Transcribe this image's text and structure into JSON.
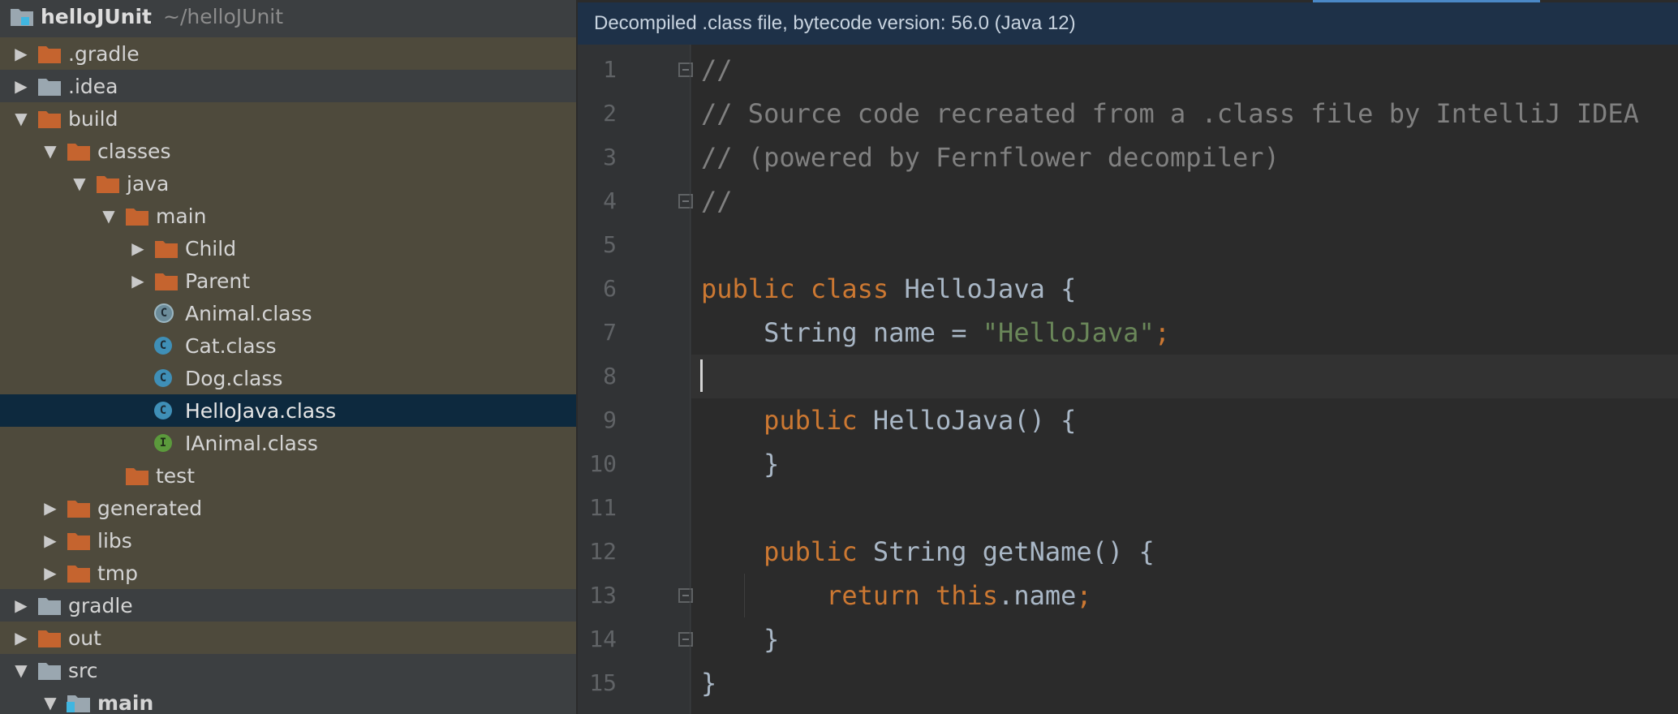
{
  "project": {
    "name": "helloJUnit",
    "path": "~/helloJUnit"
  },
  "tree": [
    {
      "label": ".gradle",
      "depth": 0,
      "arrow": "collapsed",
      "icon": "folder-orange-icon",
      "excluded": true
    },
    {
      "label": ".idea",
      "depth": 0,
      "arrow": "collapsed",
      "icon": "folder-grey-icon"
    },
    {
      "label": "build",
      "depth": 0,
      "arrow": "expanded",
      "icon": "folder-orange-icon",
      "excluded": true
    },
    {
      "label": "classes",
      "depth": 1,
      "arrow": "expanded",
      "icon": "folder-orange-icon",
      "excluded": true
    },
    {
      "label": "java",
      "depth": 2,
      "arrow": "expanded",
      "icon": "folder-orange-icon",
      "excluded": true
    },
    {
      "label": "main",
      "depth": 3,
      "arrow": "expanded",
      "icon": "folder-orange-icon",
      "excluded": true
    },
    {
      "label": "Child",
      "depth": 4,
      "arrow": "collapsed",
      "icon": "folder-orange-icon",
      "excluded": true
    },
    {
      "label": "Parent",
      "depth": 4,
      "arrow": "collapsed",
      "icon": "folder-orange-icon",
      "excluded": true
    },
    {
      "label": "Animal.class",
      "depth": 4,
      "arrow": "none",
      "icon": "abstract-class-icon",
      "excluded": true
    },
    {
      "label": "Cat.class",
      "depth": 4,
      "arrow": "none",
      "icon": "class-icon",
      "excluded": true
    },
    {
      "label": "Dog.class",
      "depth": 4,
      "arrow": "none",
      "icon": "class-icon",
      "excluded": true
    },
    {
      "label": "HelloJava.class",
      "depth": 4,
      "arrow": "none",
      "icon": "class-icon",
      "selected": true
    },
    {
      "label": "IAnimal.class",
      "depth": 4,
      "arrow": "none",
      "icon": "interface-icon",
      "excluded": true
    },
    {
      "label": "test",
      "depth": 3,
      "arrow": "none",
      "icon": "folder-orange-icon",
      "excluded": true
    },
    {
      "label": "generated",
      "depth": 1,
      "arrow": "collapsed",
      "icon": "folder-orange-icon",
      "excluded": true
    },
    {
      "label": "libs",
      "depth": 1,
      "arrow": "collapsed",
      "icon": "folder-orange-icon",
      "excluded": true
    },
    {
      "label": "tmp",
      "depth": 1,
      "arrow": "collapsed",
      "icon": "folder-orange-icon",
      "excluded": true
    },
    {
      "label": "gradle",
      "depth": 0,
      "arrow": "collapsed",
      "icon": "folder-grey-icon"
    },
    {
      "label": "out",
      "depth": 0,
      "arrow": "collapsed",
      "icon": "folder-orange-icon",
      "excluded": true
    },
    {
      "label": "src",
      "depth": 0,
      "arrow": "expanded",
      "icon": "folder-grey-icon"
    },
    {
      "label": "main",
      "depth": 1,
      "arrow": "expanded",
      "icon": "source-folder-icon",
      "bold": true
    }
  ],
  "editor": {
    "banner": "Decompiled .class file, bytecode version: 56.0 (Java 12)",
    "current_line": 8,
    "lines": [
      {
        "n": "1",
        "tokens": [
          {
            "t": "//",
            "c": "comment"
          }
        ]
      },
      {
        "n": "2",
        "tokens": [
          {
            "t": "// Source code recreated from a .class file by IntelliJ IDEA",
            "c": "comment"
          }
        ]
      },
      {
        "n": "3",
        "tokens": [
          {
            "t": "// (powered by Fernflower decompiler)",
            "c": "comment"
          }
        ]
      },
      {
        "n": "4",
        "tokens": [
          {
            "t": "//",
            "c": "comment"
          }
        ]
      },
      {
        "n": "5",
        "tokens": []
      },
      {
        "n": "6",
        "tokens": [
          {
            "t": "public class ",
            "c": "keyword"
          },
          {
            "t": "HelloJava {",
            "c": "ident"
          }
        ]
      },
      {
        "n": "7",
        "tokens": [
          {
            "t": "    String name = ",
            "c": "ident"
          },
          {
            "t": "\"HelloJava\"",
            "c": "string"
          },
          {
            "t": ";",
            "c": "keyword"
          }
        ]
      },
      {
        "n": "8",
        "tokens": []
      },
      {
        "n": "9",
        "tokens": [
          {
            "t": "    ",
            "c": "ident"
          },
          {
            "t": "public ",
            "c": "keyword"
          },
          {
            "t": "HelloJava() {",
            "c": "ident"
          }
        ]
      },
      {
        "n": "10",
        "tokens": [
          {
            "t": "    }",
            "c": "ident"
          }
        ]
      },
      {
        "n": "11",
        "tokens": []
      },
      {
        "n": "12",
        "tokens": [
          {
            "t": "    ",
            "c": "ident"
          },
          {
            "t": "public ",
            "c": "keyword"
          },
          {
            "t": "String getName() {",
            "c": "ident"
          }
        ]
      },
      {
        "n": "13",
        "tokens": [
          {
            "t": "        ",
            "c": "ident"
          },
          {
            "t": "return this",
            "c": "keyword"
          },
          {
            "t": ".name",
            "c": "ident"
          },
          {
            "t": ";",
            "c": "keyword"
          }
        ]
      },
      {
        "n": "14",
        "tokens": [
          {
            "t": "    }",
            "c": "ident"
          }
        ]
      },
      {
        "n": "15",
        "tokens": [
          {
            "t": "}",
            "c": "ident"
          }
        ]
      }
    ]
  }
}
